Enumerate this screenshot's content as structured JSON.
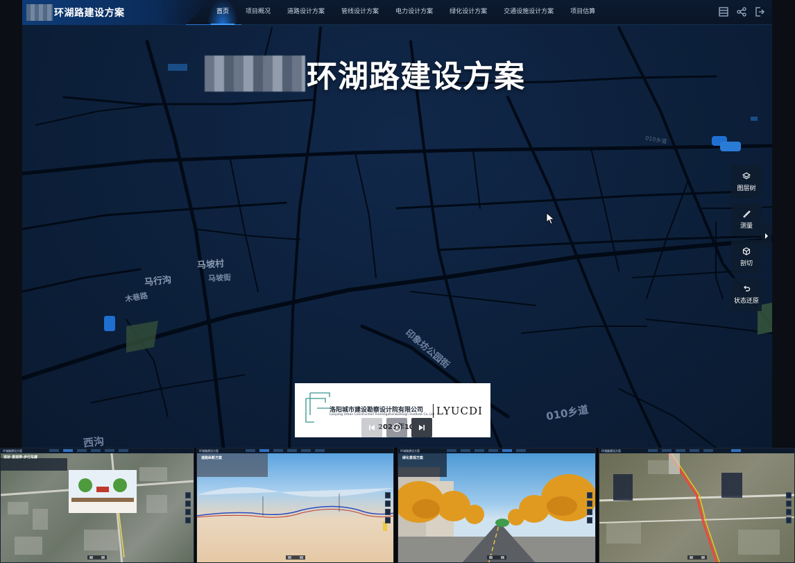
{
  "app": {
    "title": "环湖路建设方案",
    "hero_title": "环湖路建设方案"
  },
  "nav": {
    "tabs": [
      {
        "label": "首页",
        "active": true
      },
      {
        "label": "项目概况",
        "active": false
      },
      {
        "label": "道路设计方案",
        "active": false
      },
      {
        "label": "管线设计方案",
        "active": false
      },
      {
        "label": "电力设计方案",
        "active": false
      },
      {
        "label": "绿化设计方案",
        "active": false
      },
      {
        "label": "交通设施设计方案",
        "active": false
      },
      {
        "label": "项目估算",
        "active": false
      }
    ]
  },
  "top_icons": [
    "layout-icon",
    "share-icon",
    "logout-icon"
  ],
  "map": {
    "labels": [
      "马坡村",
      "马行沟",
      "马坡街",
      "木巷路",
      "印象坊公园街",
      "010乡道",
      "010乡道",
      "西沟"
    ]
  },
  "tools": [
    {
      "label": "图层树",
      "icon": "layers-icon"
    },
    {
      "label": "测量",
      "icon": "ruler-icon"
    },
    {
      "label": "剖切",
      "icon": "cube-cut-icon"
    },
    {
      "label": "状态还原",
      "icon": "undo-icon"
    }
  ],
  "player": {
    "company_cn": "洛阳城市建设勘察设计院有限公司",
    "company_en": "Luoyang Urban Construction Investigation&Design Institute Co.,Ltd",
    "company_abbr": "LYUCDI",
    "date": "2023年10月"
  },
  "thumbnails": [
    {
      "title": "环湖路建设方案",
      "panel_title": "现状-景观带-步行车廊",
      "kind": "aerial"
    },
    {
      "title": "环湖路建设方案",
      "panel_title": "道路纵断方案",
      "kind": "profile"
    },
    {
      "title": "环湖路建设方案",
      "panel_title": "绿化景观方案",
      "kind": "street"
    },
    {
      "title": "环湖路建设方案",
      "panel_title": "",
      "kind": "route"
    }
  ],
  "colors": {
    "accent": "#3b9cff",
    "nav_bg": "#0a1526",
    "map_bg": "#0d213d",
    "road": "#020a16"
  }
}
